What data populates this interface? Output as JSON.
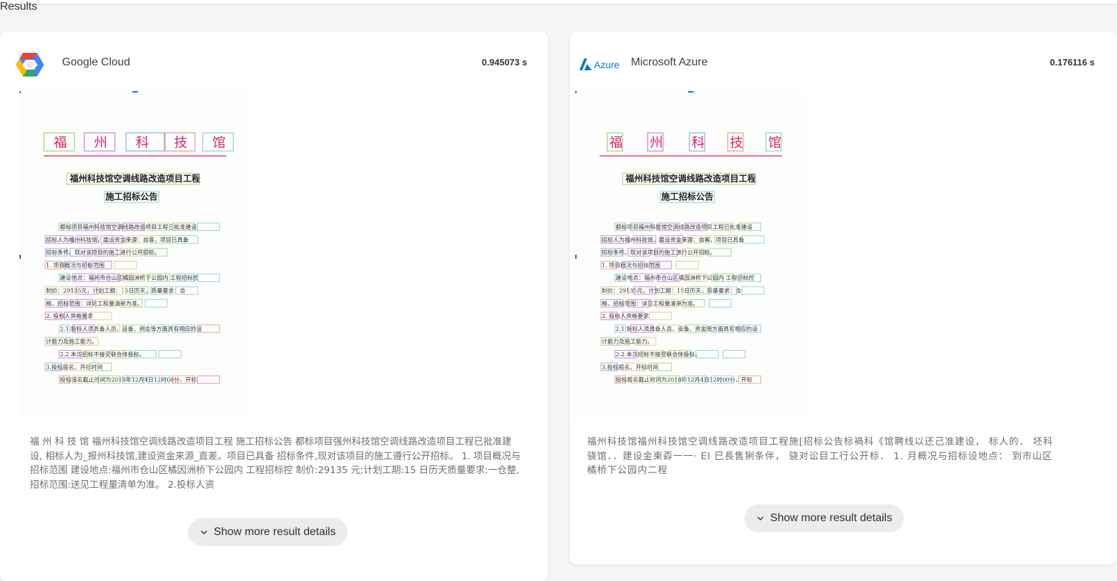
{
  "page": {
    "title": "Results"
  },
  "providers": [
    {
      "name": "Google Cloud",
      "logo_icon": "google-cloud-logo-icon",
      "time": "0.945073 s",
      "doc_text": {
        "header": [
          "福",
          "州",
          "科",
          "技",
          "馆"
        ],
        "title1": "福州科技馆空调线路改造项目工程",
        "title2": "施工招标公告",
        "lines": [
          "都标项目福州科技馆空调线路改造项目工程已批准建设",
          "招标人为福州科技馆，建设资金来源：自筹，项目已具备",
          "招标条件。现对该项目的施工进行公开招标。",
          "1. 项目概况与招标范围",
          "建设地点：福州市仓山区橘园洲桥下公园内 工程招标控",
          "制价：29135元，计划工期：15日历天，质量要求：合",
          "格，招标范围：详见工程量清单为准。",
          "2. 投标人资格要求",
          "2.1 投标人须具备人员、设备、资金等方面具有相应的设",
          "计能力及施工能力。",
          "2.2 本次招标不接受联合体投标。",
          "3.投标报名、开标时间",
          "投标报名截止时间为2018年12月4日12时00分，开标"
        ]
      },
      "ocr_text": "福 州 科 技 馆 福州科技馆空调线路改造项目工程 施工招标公告 都标项目强州科技馆空调线路改造项目工程已批准建设, 相标人为_报州科技馆,建设资金来源_直差。项目已具备 招标条件,现对该项目的施工遵行公开招标。 1. 项目概况与招标范围 建设地点:福州市仓山区橘因洲桥下公园内 工程招标控 制价:29135 元;计划工期:15 日历天质量要求:一仓整,招标范围:送见工程量清单为准。 2.投标人资",
      "more_label": "Show more result details"
    },
    {
      "name": "Microsoft Azure",
      "logo_icon": "azure-logo-icon",
      "logo_text": "Azure",
      "time": "0.176116 s",
      "ocr_text": "福州科技馆福州科技馆空调线路改造项目工程施[招标公告标禍科《馆聘线以还己准建设， 标人的． 坯科骁馆．．建设金柬孬一一· El 巳長售猁条伴， 骁对讼目工行公开标． 1. 月概况与招标设地点： 到市山区橘桥下公园内二程",
      "more_label": "Show more result details"
    }
  ],
  "colors": {
    "header_rule": "#e03c64",
    "google_red": "#ea4335",
    "google_yellow": "#fbbc04",
    "google_green": "#34a853",
    "google_blue": "#4285f4",
    "azure_blue": "#0078d4"
  }
}
